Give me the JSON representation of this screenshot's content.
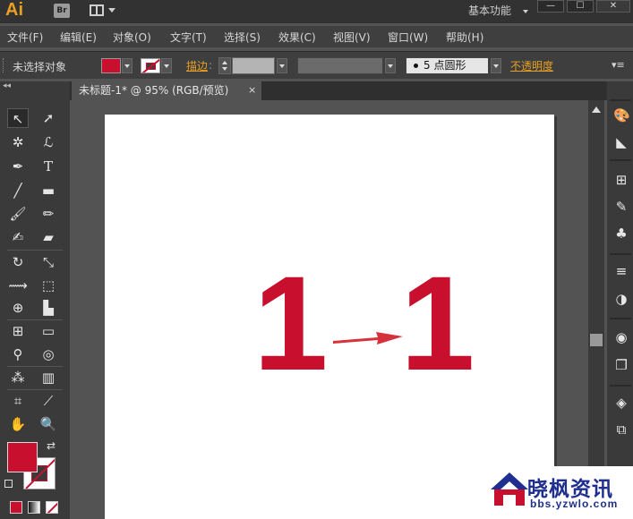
{
  "app": {
    "logo": "Ai",
    "bridge_label": "Br",
    "workspace": "基本功能",
    "window_buttons": [
      "—",
      "☐",
      "✕"
    ]
  },
  "menubar": {
    "items": [
      "文件(F)",
      "编辑(E)",
      "对象(O)",
      "文字(T)",
      "选择(S)",
      "效果(C)",
      "视图(V)",
      "窗口(W)",
      "帮助(H)"
    ]
  },
  "control_bar": {
    "selection_status": "未选择对象",
    "stroke_label": "描边",
    "brush_value": "5 点圆形",
    "opacity_label": "不透明度",
    "fill_color": "#c8102e",
    "stroke_color": "#c8102e"
  },
  "toolbar": {
    "collapse_label": "◂◂",
    "tools": [
      [
        "selection-tool",
        "direct-selection-tool"
      ],
      [
        "magic-wand-tool",
        "lasso-tool"
      ],
      [
        "pen-tool",
        "type-tool"
      ],
      [
        "line-segment-tool",
        "rectangle-tool"
      ],
      [
        "paintbrush-tool",
        "pencil-tool"
      ],
      [
        "blob-brush-tool",
        "eraser-tool"
      ],
      [
        "rotate-tool",
        "scale-tool"
      ],
      [
        "width-tool",
        "free-transform-tool"
      ],
      [
        "shape-builder-tool",
        "perspective-grid-tool"
      ],
      [
        "mesh-tool",
        "gradient-tool"
      ],
      [
        "eyedropper-tool",
        "blend-tool"
      ],
      [
        "symbol-sprayer-tool",
        "column-graph-tool"
      ],
      [
        "artboard-tool",
        "slice-tool"
      ],
      [
        "hand-tool",
        "zoom-tool"
      ]
    ]
  },
  "document": {
    "tab_title": "未标题-1* @ 95% (RGB/预览)",
    "tab_close": "×"
  },
  "artwork": {
    "left_digit": "1",
    "right_digit": "1",
    "color": "#c8102e"
  },
  "right_panel": {
    "icons": [
      "color-icon",
      "color-guide-icon",
      "swatches-icon",
      "brushes-icon",
      "symbols-icon",
      "stroke-icon",
      "transparency-icon",
      "appearance-icon",
      "graphic-styles-icon",
      "layers-icon",
      "artboards-icon"
    ]
  },
  "watermark": {
    "title": "晓枫资讯",
    "url": "bbs.yzwlo.com"
  }
}
